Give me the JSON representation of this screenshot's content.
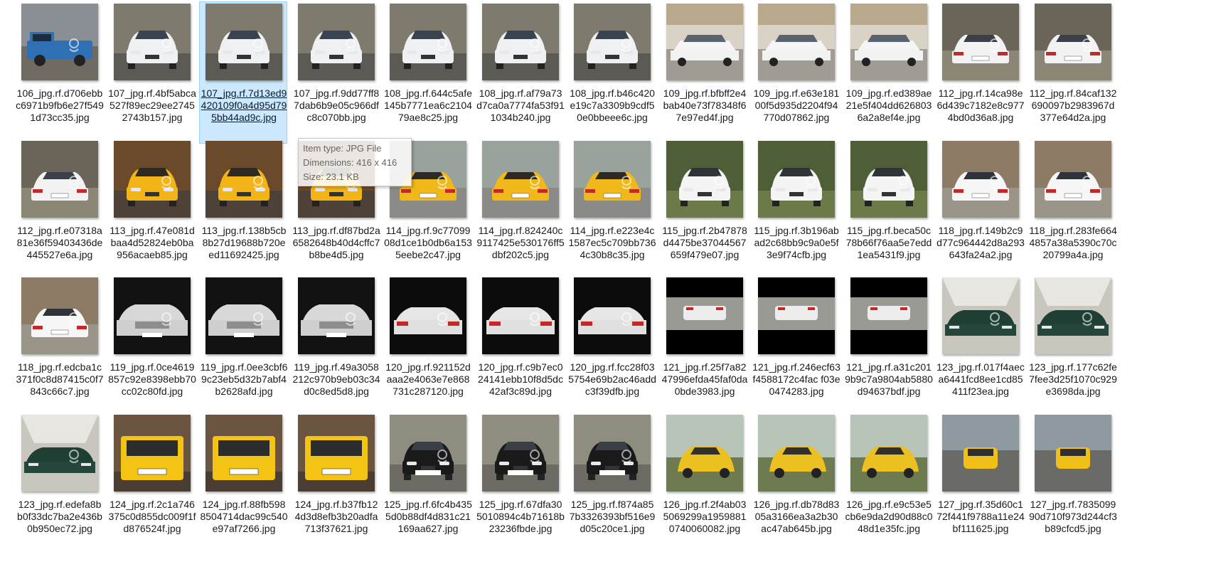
{
  "window": {
    "view": "Large icons",
    "selected_file": "107_jpg.rf.7d13ed9420109f0a4d95d795bb44ad9c.jpg"
  },
  "tooltip": {
    "type": "Item type: JPG File",
    "dimensions": "Dimensions: 416 x 416",
    "size": "Size: 23.1 KB"
  },
  "files": [
    {
      "name": "106_jpg.rf.d706ebbc6971b9fb6e27f5491d73cc35.jpg",
      "thumb": "pickup-blue"
    },
    {
      "name": "107_jpg.rf.4bf5abca527f89ec29ee27452743b157.jpg",
      "thumb": "hatch-white"
    },
    {
      "name": "107_jpg.rf.7d13ed9420109f0a4d95d795bb44ad9c.jpg",
      "thumb": "hatch-white",
      "selected": true
    },
    {
      "name": "107_jpg.rf.9dd77ff87dab6b9e05c966dfc8c070bb.jpg",
      "thumb": "hatch-white"
    },
    {
      "name": "108_jpg.rf.644c5afe145b7771ea6c210479ae8c25.jpg",
      "thumb": "hatch-white"
    },
    {
      "name": "108_jpg.rf.af79a73d7ca0a7774fa53f911034b240.jpg",
      "thumb": "hatch-white"
    },
    {
      "name": "108_jpg.rf.b46c420e19c7a3309b9cdf50e0bbeee6c.jpg",
      "thumb": "hatch-white"
    },
    {
      "name": "109_jpg.rf.bfbff2e4bab40e73f78348f67e97ed4f.jpg",
      "thumb": "sedan-white-yard"
    },
    {
      "name": "109_jpg.rf.e63e18100f5d935d2204f94770d07862.jpg",
      "thumb": "sedan-white-yard"
    },
    {
      "name": "109_jpg.rf.ed389ae21e5f404dd6268036a2a8ef4e.jpg",
      "thumb": "sedan-white-yard"
    },
    {
      "name": "112_jpg.rf.14ca98e6d439c7182e8c9774bd0d36a8.jpg",
      "thumb": "sedan-white-rear"
    },
    {
      "name": "112_jpg.rf.84caf132690097b2983967d377e64d2a.jpg",
      "thumb": "sedan-white-rear"
    },
    {
      "name": "112_jpg.rf.e07318a81e36f59403436de445527e6a.jpg",
      "thumb": "sedan-white-rear"
    },
    {
      "name": "113_jpg.rf.47e081dbaa4d52824eb0ba956acaeb85.jpg",
      "thumb": "taxi-yellow-front"
    },
    {
      "name": "113_jpg.rf.138b5cb8b27d19688b720eed11692425.jpg",
      "thumb": "taxi-yellow-front"
    },
    {
      "name": "113_jpg.rf.df87bd2a6582648b40d4cffc7b8be4d5.jpg",
      "thumb": "taxi-yellow-front"
    },
    {
      "name": "114_jpg.rf.9c7709908d1ce1b0db6a1535eebe2c47.jpg",
      "thumb": "taxi-yellow-rear"
    },
    {
      "name": "114_jpg.rf.824240c9117425e530176ff5dbf202c5.jpg",
      "thumb": "taxi-yellow-rear"
    },
    {
      "name": "114_jpg.rf.e223e4c1587ec5c709bb7364c30b8c35.jpg",
      "thumb": "taxi-yellow-rear"
    },
    {
      "name": "115_jpg.rf.2b47878d4475be37044567659f479e07.jpg",
      "thumb": "hatch-white-grass"
    },
    {
      "name": "115_jpg.rf.3b196abad2c68bb9c9a0e5f3e9f74cfb.jpg",
      "thumb": "hatch-white-grass"
    },
    {
      "name": "115_jpg.rf.beca50c78b66f76aa5e7edd1ea5431f9.jpg",
      "thumb": "hatch-white-grass"
    },
    {
      "name": "118_jpg.rf.149b2c9d77c964442d8a293643fa24a2.jpg",
      "thumb": "suv-white-rear"
    },
    {
      "name": "118_jpg.rf.283fe6644857a38a5390c70c20799a4a.jpg",
      "thumb": "suv-white-rear"
    },
    {
      "name": "118_jpg.rf.edcba1c371f0c8d87415c0f7843c66c7.jpg",
      "thumb": "suv-white-rear"
    },
    {
      "name": "119_jpg.rf.0ce4619857c92e8398ebb70cc02c80fd.jpg",
      "thumb": "sedan-silver-dark"
    },
    {
      "name": "119_jpg.rf.0ee3cbf69c23eb5d32b7abf4b2628afd.jpg",
      "thumb": "sedan-silver-dark"
    },
    {
      "name": "119_jpg.rf.49a3058212c970b9eb03c34d0c8ed5d8.jpg",
      "thumb": "sedan-silver-dark"
    },
    {
      "name": "120_jpg.rf.921152daaa2e4063e7e868731c287120.jpg",
      "thumb": "car-dark-rear"
    },
    {
      "name": "120_jpg.rf.c9b7ec024141ebb10f8d5dc42af3c89d.jpg",
      "thumb": "car-dark-rear"
    },
    {
      "name": "120_jpg.rf.fcc28f035754e69b2ac46addc3f39dfb.jpg",
      "thumb": "car-dark-rear"
    },
    {
      "name": "121_jpg.rf.25f7a8247996efda45faf0da0bde3983.jpg",
      "thumb": "car-letterbox"
    },
    {
      "name": "121_jpg.rf.246ecf63f4588172c4fac f03e0474283.jpg",
      "thumb": "car-letterbox"
    },
    {
      "name": "121_jpg.rf.a31c2019b9c7a9804ab5880d94637bdf.jpg",
      "thumb": "car-letterbox"
    },
    {
      "name": "123_jpg.rf.017f4aeca6441fcd8ee1cd85411f23ea.jpg",
      "thumb": "sedan-green-garage"
    },
    {
      "name": "123_jpg.rf.177c62fe7fee3d25f1070c929e3698da.jpg",
      "thumb": "sedan-green-garage"
    },
    {
      "name": "123_jpg.rf.edefa8bb0f33dc7ba2e436b0b950ec72.jpg",
      "thumb": "sedan-green-garage"
    },
    {
      "name": "124_jpg.rf.2c1a746375c0d855dc009f1fd876524f.jpg",
      "thumb": "pride-yellow"
    },
    {
      "name": "124_jpg.rf.88fb5988504714dac99c540e97af7266.jpg",
      "thumb": "pride-yellow"
    },
    {
      "name": "124_jpg.rf.b37fb124d3d8efb3b20adfa713f37621.jpg",
      "thumb": "pride-yellow"
    },
    {
      "name": "125_jpg.rf.6fc4b4355d0b88df4d831c21169aa627.jpg",
      "thumb": "suv-black-front"
    },
    {
      "name": "125_jpg.rf.67dfa305010894c4b71618b23236fbde.jpg",
      "thumb": "suv-black-front"
    },
    {
      "name": "125_jpg.rf.f874a857b3326393bf516e9d05c20ce1.jpg",
      "thumb": "suv-black-front"
    },
    {
      "name": "126_jpg.rf.2f4ab035069299a19598810740060082.jpg",
      "thumb": "hatch-yellow-park"
    },
    {
      "name": "126_jpg.rf.db78d8305a3166ea3a2b30ac47ab645b.jpg",
      "thumb": "hatch-yellow-park"
    },
    {
      "name": "126_jpg.rf.e9c53e5cb6e9da2d90d88c048d1e35fc.jpg",
      "thumb": "hatch-yellow-park"
    },
    {
      "name": "127_jpg.rf.35d60c172f441f9788a11e24bf111625.jpg",
      "thumb": "taxi-yellow-road"
    },
    {
      "name": "127_jpg.rf.783509990d710f973d244cf3b89cfcd5.jpg",
      "thumb": "taxi-yellow-road"
    }
  ]
}
